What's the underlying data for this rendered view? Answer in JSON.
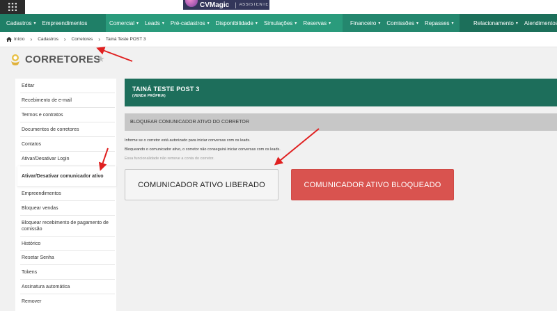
{
  "header": {
    "brand": "CVMagic",
    "brand_sub": "ASSISTENTE"
  },
  "nav": {
    "items": [
      {
        "label": "Cadastros"
      },
      {
        "label": "Empreendimentos"
      },
      {
        "label": "Comercial"
      },
      {
        "label": "Leads"
      },
      {
        "label": "Pré-cadastros"
      },
      {
        "label": "Disponibilidade"
      },
      {
        "label": "Simulações"
      },
      {
        "label": "Reservas"
      },
      {
        "label": "Financeiro"
      },
      {
        "label": "Comissões"
      },
      {
        "label": "Repasses"
      },
      {
        "label": "Relacionamento"
      },
      {
        "label": "Atendimentos"
      }
    ]
  },
  "breadcrumb": {
    "items": [
      "Início",
      "Cadastros",
      "Corretores",
      "Tainá Teste POST 3"
    ]
  },
  "page": {
    "title": "CORRETORES"
  },
  "sidebar": {
    "items": [
      {
        "label": "Editar"
      },
      {
        "label": "Recebimento de e-mail"
      },
      {
        "label": "Termos e contratos"
      },
      {
        "label": "Documentos de corretores"
      },
      {
        "label": "Contatos"
      },
      {
        "label": "Ativar/Desativar Login"
      },
      {
        "label": "Ativar/Desativar comunicador ativo"
      },
      {
        "label": "Empreendimentos"
      },
      {
        "label": "Bloquear vendas"
      },
      {
        "label": "Bloquear recebimento de pagamento de comissão"
      },
      {
        "label": "Histórico"
      },
      {
        "label": "Resetar Senha"
      },
      {
        "label": "Tokens"
      },
      {
        "label": "Assinatura automática"
      },
      {
        "label": "Remover"
      }
    ]
  },
  "content": {
    "broker_name": "TAINÁ TESTE POST 3",
    "broker_type": "(VENDA PRÓPRIA)",
    "section_title": "BLOQUEAR COMUNICADOR ATIVO DO CORRETOR",
    "info_1": "Informe se o corretor está autorizado para iniciar conversas com os leads.",
    "info_2": "Bloqueando o comunicador ativo, o corretor não conseguirá iniciar conversas com os leads.",
    "info_3": "Essa funcionalidade não remove a conta do corretor.",
    "btn_liberado": "COMUNICADOR ATIVO LIBERADO",
    "btn_bloqueado": "COMUNICADOR ATIVO BLOQUEADO"
  },
  "colors": {
    "nav_dark": "#1e7a63",
    "nav_light": "#2a9b7c",
    "header_card": "#1d6e5b",
    "danger": "#d9534f",
    "annotation": "#e02020"
  }
}
